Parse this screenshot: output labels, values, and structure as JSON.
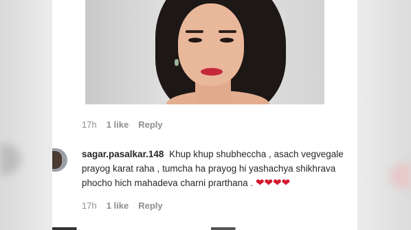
{
  "post": {
    "photo_alt": "photo",
    "meta": {
      "time": "17h",
      "likes": "1 like",
      "reply": "Reply"
    }
  },
  "comment": {
    "username": "sagar.pasalkar.148",
    "text_line1": "Khup khup shubheccha , asach vegvegale",
    "text_line2": "prayog karat raha , tumcha ha prayog hi yashachya shikhrava",
    "text_line3": "phocho hich mahadeva charni prarthana .",
    "hearts": [
      "❤",
      "❤",
      "❤",
      "❤"
    ],
    "meta": {
      "time": "17h",
      "likes": "1 like",
      "reply": "Reply"
    }
  },
  "colors": {
    "heart": "#d3172e",
    "meta_text": "#8e8e8e",
    "text": "#262626"
  }
}
